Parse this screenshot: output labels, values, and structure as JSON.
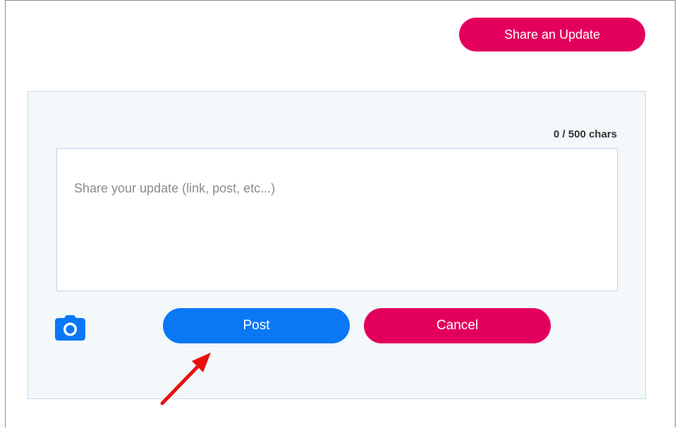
{
  "header": {
    "share_button_label": "Share an Update"
  },
  "composer": {
    "char_count": "0 / 500 chars",
    "textarea_placeholder": "Share your update (link, post, etc...)",
    "textarea_value": "",
    "camera_icon": "camera-icon",
    "post_label": "Post",
    "cancel_label": "Cancel"
  },
  "colors": {
    "accent_pink": "#e3005d",
    "accent_blue": "#0a78f5",
    "panel_bg": "#f3f8fa",
    "annotation_arrow": "#e81010"
  }
}
